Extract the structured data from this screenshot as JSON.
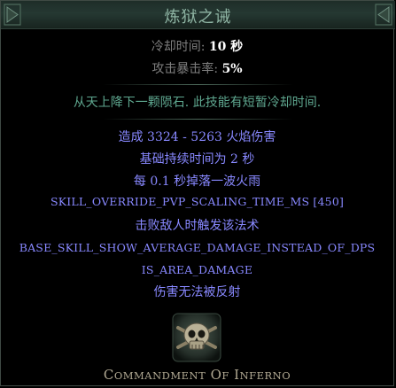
{
  "title": "炼狱之诫",
  "properties": [
    {
      "label": "冷却时间: ",
      "value": "10 秒"
    },
    {
      "label": "攻击暴击率: ",
      "value": "5%"
    }
  ],
  "description": "从天上降下一颗陨石. 此技能有短暂冷却时间.",
  "mods": [
    "造成 3324 - 5263 火焰伤害",
    "基础持续时间为 2 秒",
    "每 0.1 秒掉落一波火雨",
    "SKILL_OVERRIDE_PVP_SCALING_TIME_MS [450]",
    "击败敌人时触发该法术",
    "BASE_SKILL_SHOW_AVERAGE_DAMAGE_INSTEAD_OF_DPS",
    "IS_AREA_DAMAGE",
    "伤害无法被反射"
  ],
  "gem": {
    "icon": "skull-gem-icon",
    "name": "Commandment of Inferno"
  },
  "colors": {
    "header_text": "#8fb5a4",
    "property_label": "#7f7f7f",
    "property_value": "#ffffff",
    "description": "#5fa890",
    "mod": "#8888ff",
    "gem_name": "#b0a892"
  }
}
